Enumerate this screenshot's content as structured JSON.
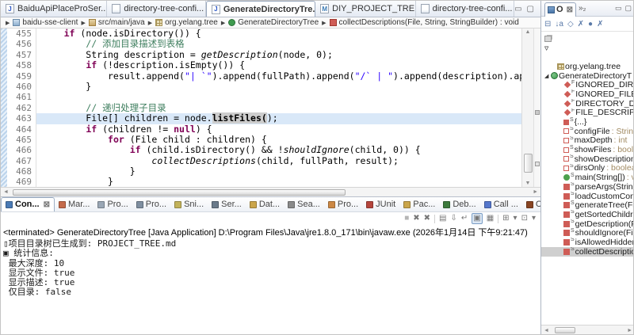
{
  "editor_tabs": {
    "tabs": [
      {
        "label": "BaiduApiPlaceProSer...",
        "icon": "java-file",
        "active": false
      },
      {
        "label": "directory-tree-confi...",
        "icon": "text-file",
        "active": false
      },
      {
        "label": "GenerateDirectoryTre...",
        "icon": "java-file",
        "active": true,
        "close": "⊠"
      },
      {
        "label": "DIY_PROJECT_TREE.md",
        "icon": "md-file",
        "active": false
      },
      {
        "label": "directory-tree-confi...",
        "icon": "text-file",
        "active": false
      }
    ],
    "window_buttons": [
      "▭",
      "▢"
    ]
  },
  "breadcrumb": {
    "leading_arrow": "▶",
    "separator": "▶",
    "items": [
      {
        "icon": "project",
        "label": "baidu-sse-client"
      },
      {
        "icon": "srcfolder",
        "label": "src/main/java"
      },
      {
        "icon": "package",
        "label": "org.yelang.tree"
      },
      {
        "icon": "class",
        "label": "GenerateDirectoryTree"
      },
      {
        "icon": "method",
        "label": "collectDescriptions(File, String, StringBuilder) : void"
      }
    ]
  },
  "editor": {
    "scroll_up": "▲",
    "scroll_down": "▼",
    "scroll_left": "◄",
    "scroll_right": "►",
    "lines": [
      {
        "n": "455",
        "seg": [
          [
            "p",
            "     "
          ],
          [
            "k",
            "if"
          ],
          [
            "p",
            " (node.isDirectory()) {"
          ]
        ]
      },
      {
        "n": "456",
        "seg": [
          [
            "p",
            "         "
          ],
          [
            "c",
            "// 添加目录描述到表格"
          ]
        ]
      },
      {
        "n": "457",
        "seg": [
          [
            "p",
            "         String description = "
          ],
          [
            "m",
            "getDescription"
          ],
          [
            "p",
            "(node, 0);"
          ]
        ]
      },
      {
        "n": "458",
        "seg": [
          [
            "p",
            "         "
          ],
          [
            "k",
            "if"
          ],
          [
            "p",
            " (!description.isEmpty()) {"
          ]
        ]
      },
      {
        "n": "459",
        "seg": [
          [
            "p",
            "             result.append("
          ],
          [
            "s",
            "\"| `\""
          ],
          [
            "p",
            ").append(fullPath).append("
          ],
          [
            "s",
            "\"/` | \""
          ],
          [
            "p",
            ").append(description).append("
          ]
        ]
      },
      {
        "n": "460",
        "seg": [
          [
            "p",
            "         }"
          ]
        ]
      },
      {
        "n": "461",
        "seg": []
      },
      {
        "n": "462",
        "seg": [
          [
            "p",
            "         "
          ],
          [
            "c",
            "// 递归处理子目录"
          ]
        ]
      },
      {
        "n": "463",
        "cur": true,
        "seg": [
          [
            "p",
            "         File[] children = node."
          ],
          [
            "hl",
            "listFiles("
          ],
          [
            "p",
            ");"
          ]
        ]
      },
      {
        "n": "464",
        "seg": [
          [
            "p",
            "         "
          ],
          [
            "k",
            "if"
          ],
          [
            "p",
            " (children != "
          ],
          [
            "k",
            "null"
          ],
          [
            "p",
            ") {"
          ]
        ]
      },
      {
        "n": "465",
        "seg": [
          [
            "p",
            "             "
          ],
          [
            "k",
            "for"
          ],
          [
            "p",
            " (File child : children) {"
          ]
        ]
      },
      {
        "n": "466",
        "seg": [
          [
            "p",
            "                 "
          ],
          [
            "k",
            "if"
          ],
          [
            "p",
            " (child.isDirectory() && !"
          ],
          [
            "m",
            "shouldIgnore"
          ],
          [
            "p",
            "(child, 0)) {"
          ]
        ]
      },
      {
        "n": "467",
        "seg": [
          [
            "p",
            "                     "
          ],
          [
            "m",
            "collectDescriptions"
          ],
          [
            "p",
            "(child, fullPath, result);"
          ]
        ]
      },
      {
        "n": "468",
        "seg": [
          [
            "p",
            "                 }"
          ]
        ]
      },
      {
        "n": "469",
        "seg": [
          [
            "p",
            "             }"
          ]
        ]
      }
    ]
  },
  "console": {
    "tabs": [
      {
        "label": "Con...",
        "icon": "console",
        "color": "#4a7ab5",
        "active": true,
        "close": "⊠"
      },
      {
        "label": "Mar...",
        "icon": "markers",
        "color": "#c46a4a",
        "active": false
      },
      {
        "label": "Pro...",
        "icon": "problems",
        "color": "#9aa7b5",
        "active": false
      },
      {
        "label": "Pro...",
        "icon": "progress",
        "color": "#7f8fa0",
        "active": false
      },
      {
        "label": "Sni...",
        "icon": "snippets",
        "color": "#c2b25a",
        "active": false
      },
      {
        "label": "Ser...",
        "icon": "servers",
        "color": "#6a7a8a",
        "active": false
      },
      {
        "label": "Dat...",
        "icon": "data-source",
        "color": "#caa54a",
        "active": false
      },
      {
        "label": "Sea...",
        "icon": "search",
        "color": "#8a8a8a",
        "active": false
      },
      {
        "label": "Pro...",
        "icon": "properties",
        "color": "#cc8844",
        "active": false
      },
      {
        "label": "JUnit",
        "icon": "junit",
        "color": "#b5453c",
        "active": false
      },
      {
        "label": "Pac...",
        "icon": "package-explorer",
        "color": "#caa54a",
        "active": false
      },
      {
        "label": "Deb...",
        "icon": "debug",
        "color": "#3c7a3c",
        "active": false
      },
      {
        "label": "Call ...",
        "icon": "call-hierarchy",
        "color": "#5577cc",
        "active": false
      },
      {
        "label": "Cov...",
        "icon": "coverage",
        "color": "#884422",
        "active": false
      }
    ],
    "window_buttons": [
      "▭",
      "▢"
    ],
    "toolbar": [
      {
        "name": "terminate",
        "glyph": "■",
        "dim": true
      },
      {
        "name": "remove-launch",
        "glyph": "✖"
      },
      {
        "name": "remove-all-launches",
        "glyph": "✖"
      },
      {
        "name": "sep1",
        "sep": true
      },
      {
        "name": "clear-console",
        "glyph": "▤"
      },
      {
        "name": "scroll-lock",
        "glyph": "⇩"
      },
      {
        "name": "word-wrap",
        "glyph": "↵"
      },
      {
        "name": "pin-console",
        "glyph": "▣",
        "pressed": true
      },
      {
        "name": "display-selected-console",
        "glyph": "▦"
      },
      {
        "name": "sep2",
        "sep": true
      },
      {
        "name": "open-console",
        "glyph": "⊞"
      },
      {
        "name": "open-console-menu",
        "glyph": "▾"
      },
      {
        "name": "new-console-view",
        "glyph": "⊡"
      },
      {
        "name": "new-console-view-menu",
        "glyph": "▾"
      }
    ],
    "header": "<terminated> GenerateDirectoryTree [Java Application] D:\\Program Files\\Java\\jre1.8.0_171\\bin\\javaw.exe (2026年1月14日 下午9:21:47)",
    "lines": [
      "▯项目目录树已生成到: PROJECT_TREE.md",
      "▣ 统计信息:",
      " 最大深度: 10",
      " 显示文件: true",
      " 显示描述: true",
      " 仅目录: false"
    ]
  },
  "outline": {
    "tab_label": "O",
    "tab_close": "⊠",
    "more_indicator": "»₂",
    "window_buttons": [
      "▭",
      "▢"
    ],
    "toolbar": [
      {
        "name": "collapse-all",
        "glyph": "⊟"
      },
      {
        "name": "sort",
        "glyph": "↓a"
      },
      {
        "name": "hide-fields",
        "glyph": "◇"
      },
      {
        "name": "hide-static-members",
        "glyph": "✗"
      },
      {
        "name": "hide-non-public",
        "glyph": "●"
      },
      {
        "name": "hide-local-types",
        "glyph": "✗"
      }
    ],
    "rows": [
      {
        "icon": "imports",
        "label": "",
        "indent": 0
      },
      {
        "icon": "chevron",
        "label": "▿",
        "indent": 0
      },
      {
        "icon": "none",
        "label": "",
        "indent": 0
      },
      {
        "icon": "package",
        "label": "org.yelang.tree",
        "indent": 1
      },
      {
        "icon": "class",
        "label": "GenerateDirectoryT",
        "indent": 0,
        "arrow": "◢"
      },
      {
        "icon": "sff",
        "dec": "F",
        "label": "IGNORED_DIRS",
        "type": ":",
        "indent": 2
      },
      {
        "icon": "sff",
        "dec": "F",
        "label": "IGNORED_FILES",
        "indent": 2
      },
      {
        "icon": "sff",
        "dec": "F",
        "label": "DIRECTORY_DES",
        "indent": 2
      },
      {
        "icon": "sff",
        "dec": "F",
        "label": "FILE_DESCRIPTIO",
        "indent": 2
      },
      {
        "icon": "init",
        "dec": "S",
        "label": "{...}",
        "indent": 2
      },
      {
        "icon": "field",
        "dec": "S",
        "label": "configFile",
        "type": ": String",
        "indent": 2
      },
      {
        "icon": "field",
        "dec": "S",
        "label": "maxDepth",
        "type": ": int",
        "indent": 2
      },
      {
        "icon": "field",
        "dec": "S",
        "label": "showFiles",
        "type": ": boole",
        "indent": 2
      },
      {
        "icon": "field",
        "dec": "S",
        "label": "showDescription",
        "indent": 2
      },
      {
        "icon": "field",
        "dec": "S",
        "label": "dirsOnly",
        "type": ": boolea",
        "indent": 2
      },
      {
        "icon": "method-public",
        "dec": "S",
        "label": "main(String[])",
        "type": ": v",
        "indent": 2
      },
      {
        "icon": "method-private",
        "dec": "S",
        "label": "parseArgs(String",
        "indent": 2
      },
      {
        "icon": "method-private",
        "dec": "S",
        "label": "loadCustomConf",
        "indent": 2
      },
      {
        "icon": "method-private",
        "dec": "S",
        "label": "generateTree(File",
        "indent": 2
      },
      {
        "icon": "method-private",
        "dec": "S",
        "label": "getSortedChildre",
        "indent": 2
      },
      {
        "icon": "method-private",
        "dec": "S",
        "label": "getDescription(F",
        "indent": 2
      },
      {
        "icon": "method-private",
        "dec": "S",
        "label": "shouldIgnore(File",
        "indent": 2
      },
      {
        "icon": "method-private",
        "dec": "S",
        "label": "isAllowedHidden",
        "indent": 2
      },
      {
        "icon": "method-private",
        "dec": "S",
        "label": "collectDescriptio",
        "indent": 2,
        "selected": true
      }
    ],
    "hscroll_arrows": [
      "◄",
      "►"
    ]
  }
}
